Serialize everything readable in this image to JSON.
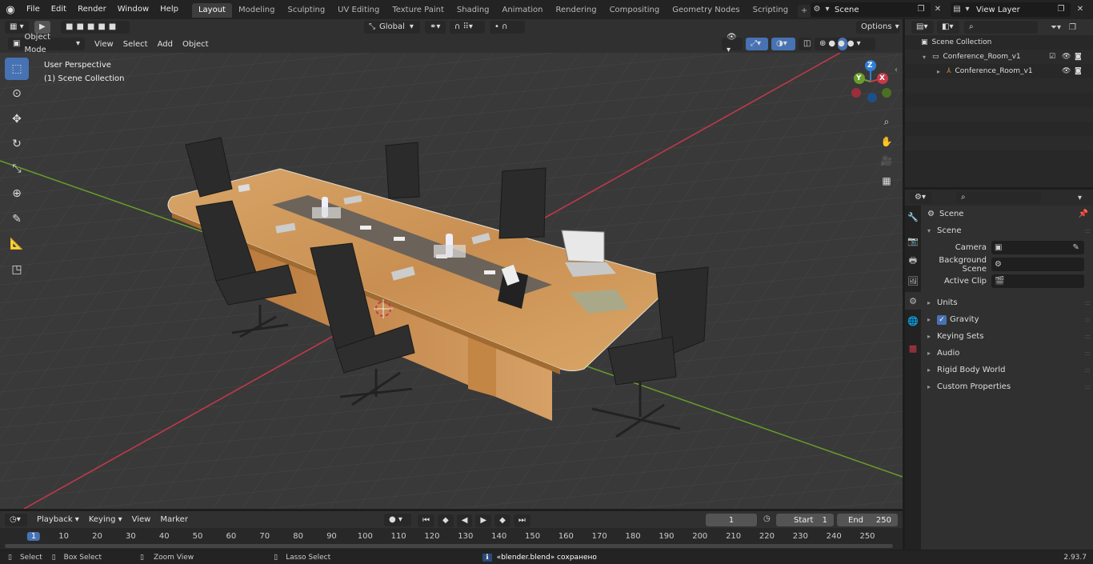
{
  "app": {
    "menus": [
      "File",
      "Edit",
      "Render",
      "Window",
      "Help"
    ],
    "workspaces": [
      "Layout",
      "Modeling",
      "Sculpting",
      "UV Editing",
      "Texture Paint",
      "Shading",
      "Animation",
      "Rendering",
      "Compositing",
      "Geometry Nodes",
      "Scripting"
    ],
    "active_workspace": "Layout",
    "add_tab": "+",
    "scene_name": "Scene",
    "view_layer": "View Layer"
  },
  "viewport_header": {
    "mode": "Object Mode",
    "menus": [
      "View",
      "Select",
      "Add",
      "Object"
    ],
    "orientation": "Global",
    "options": "Options"
  },
  "viewport": {
    "perspective_label": "User Perspective",
    "collection_label": "(1) Scene Collection",
    "axis_x": "X",
    "axis_y": "Y",
    "axis_z": "Z"
  },
  "outliner": {
    "root": "Scene Collection",
    "collection": "Conference_Room_v1",
    "object": "Conference_Room_v1"
  },
  "properties": {
    "header": "Scene",
    "section": "Scene",
    "fields": [
      {
        "label": "Camera",
        "value": ""
      },
      {
        "label": "Background Scene",
        "value": ""
      },
      {
        "label": "Active Clip",
        "value": ""
      }
    ],
    "panels": [
      "Units",
      "Gravity",
      "Keying Sets",
      "Audio",
      "Rigid Body World",
      "Custom Properties"
    ],
    "gravity_checked": true
  },
  "timeline": {
    "menus": [
      "Playback",
      "Keying",
      "View",
      "Marker"
    ],
    "current_frame": "1",
    "start_label": "Start",
    "start_value": "1",
    "end_label": "End",
    "end_value": "250",
    "ticks": [
      "1",
      "10",
      "20",
      "30",
      "40",
      "50",
      "60",
      "70",
      "80",
      "90",
      "100",
      "110",
      "120",
      "130",
      "140",
      "150",
      "160",
      "170",
      "180",
      "190",
      "200",
      "210",
      "220",
      "230",
      "240",
      "250"
    ]
  },
  "statusbar": {
    "select": "Select",
    "box_select": "Box Select",
    "zoom_view": "Zoom View",
    "lasso_select": "Lasso Select",
    "message": "«blender.blend» сохранено",
    "version": "2.93.7"
  },
  "colors": {
    "accent": "#4772b3",
    "x_axis": "#c8384b",
    "y_axis": "#6a9c2a",
    "z_axis": "#2f7fd6"
  }
}
